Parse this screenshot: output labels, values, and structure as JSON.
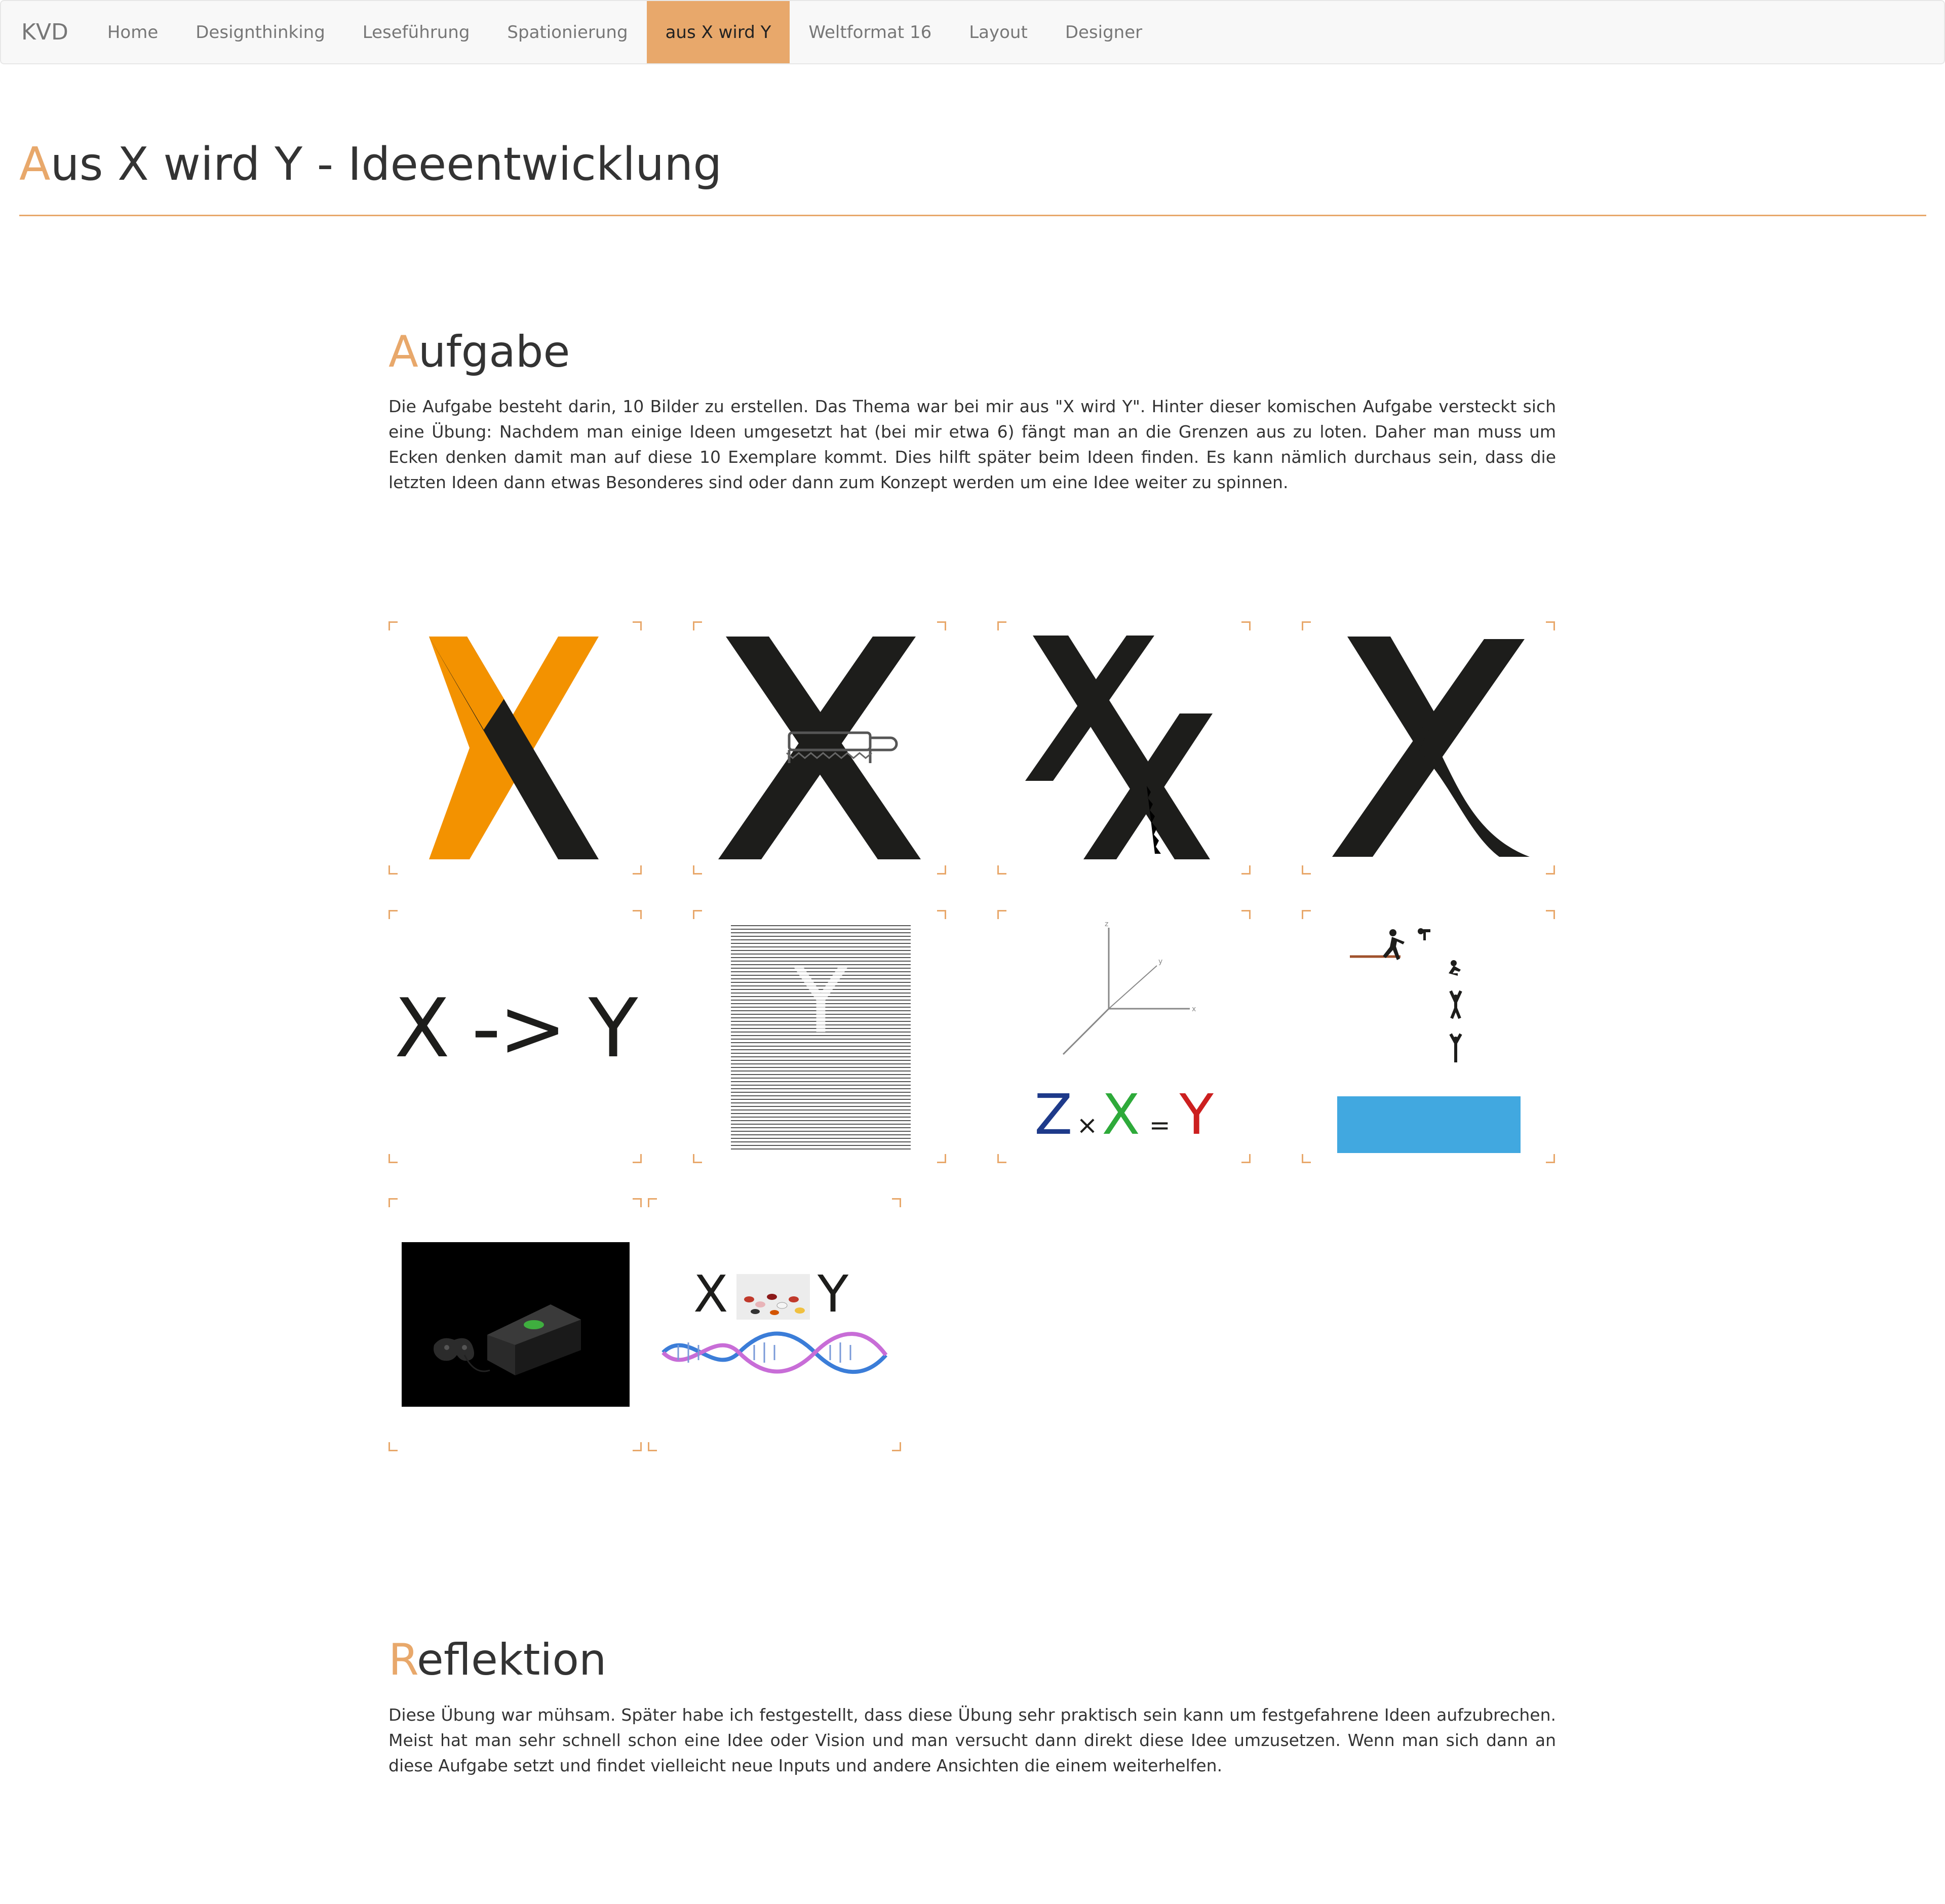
{
  "nav": {
    "brand": "KVD",
    "items": [
      {
        "label": "Home"
      },
      {
        "label": "Designthinking"
      },
      {
        "label": "Leseführung"
      },
      {
        "label": "Spationierung"
      },
      {
        "label": "aus X wird Y",
        "active": true
      },
      {
        "label": "Weltformat 16"
      },
      {
        "label": "Layout"
      },
      {
        "label": "Designer"
      }
    ]
  },
  "page": {
    "title_initial": "A",
    "title_rest": "us X wird Y - Ideeentwicklung"
  },
  "aufgabe": {
    "heading_initial": "A",
    "heading_rest": "ufgabe",
    "text": "Die Aufgabe besteht darin, 10 Bilder zu erstellen. Das Thema war bei mir aus \"X wird Y\". Hinter dieser komischen Aufgabe versteckt sich eine Übung: Nachdem man einige Ideen umgesetzt hat (bei mir etwa 6) fängt man an die Grenzen aus zu loten. Daher man muss um Ecken denken damit man auf diese 10 Exemplare kommt. Dies hilft später beim Ideen finden. Es kann nämlich durchaus sein, dass die letzten Ideen dann etwas Besonderes sind oder dann zum Konzept werden um eine Idee weiter zu spinnen."
  },
  "gallery": {
    "arrow_text": "X -> Y",
    "hidden_y": "Y",
    "formula": {
      "z": "Z",
      "times": "×",
      "x": "X",
      "equals": "=",
      "y": "Y"
    },
    "axes": {
      "z": "z",
      "y": "y",
      "x": "x"
    },
    "pill_x": "X",
    "pill_y": "Y",
    "colors": {
      "accent": "#e8a86b",
      "orange_x": "#f39200",
      "dark": "#1d1d1b",
      "blue_box": "#41a8e0",
      "formula_z": "#1e3a8a",
      "formula_x": "#2eaa3a",
      "formula_y": "#cc1f1f"
    },
    "images": [
      {
        "name": "orange-half-x"
      },
      {
        "name": "x-with-saw"
      },
      {
        "name": "split-x"
      },
      {
        "name": "x-with-curved-leg"
      },
      {
        "name": "x-arrow-y"
      },
      {
        "name": "hidden-y-lines"
      },
      {
        "name": "axes-formula"
      },
      {
        "name": "falling-figures"
      },
      {
        "name": "xbox-console"
      },
      {
        "name": "x-pills-y-dna"
      }
    ]
  },
  "reflektion": {
    "heading_initial": "R",
    "heading_rest": "eflektion",
    "text": "Diese Übung war mühsam. Später habe ich festgestellt, dass diese Übung sehr praktisch sein kann um festgefahrene Ideen aufzubrechen. Meist hat man sehr schnell schon eine Idee oder Vision und man versucht dann direkt diese Idee umzusetzen. Wenn man sich dann an diese Aufgabe setzt und findet vielleicht neue Inputs und andere Ansichten die einem weiterhelfen."
  }
}
